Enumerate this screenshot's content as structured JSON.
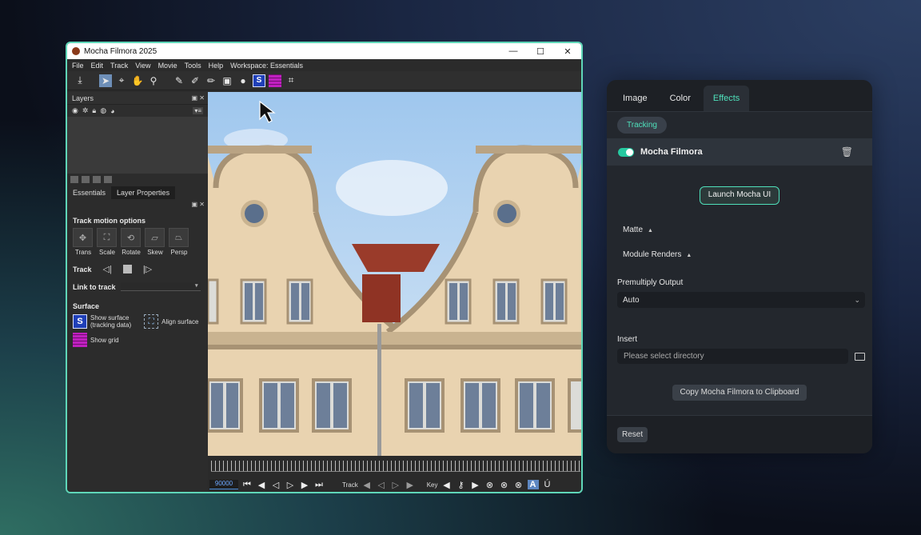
{
  "mocha": {
    "title": "Mocha Filmora 2025",
    "window_controls": [
      "—",
      "☐",
      "✕"
    ],
    "menu": [
      "File",
      "Edit",
      "Track",
      "View",
      "Movie",
      "Tools",
      "Help",
      "Workspace: Essentials"
    ],
    "layers_title": "Layers",
    "panel_tabs": [
      "Essentials",
      "Layer Properties"
    ],
    "track_motion_title": "Track motion options",
    "motion_options": [
      "Trans",
      "Scale",
      "Rotate",
      "Skew",
      "Persp"
    ],
    "track_label": "Track",
    "link_to_track_label": "Link to track",
    "surface_title": "Surface",
    "show_surface_label": "Show surface",
    "tracking_data_label": "(tracking data)",
    "align_surface_label": "Align surface",
    "show_grid_label": "Show grid",
    "timeline": {
      "frame": "90000",
      "track_label": "Track",
      "key_label": "Key"
    }
  },
  "filmora": {
    "tabs": [
      "Image",
      "Color",
      "Effects"
    ],
    "active_tab": "Effects",
    "subtab": "Tracking",
    "effect_name": "Mocha Filmora",
    "launch_button": "Launch Mocha UI",
    "matte_label": "Matte",
    "module_renders_label": "Module Renders",
    "premultiply_label": "Premultiply Output",
    "premultiply_value": "Auto",
    "insert_label": "Insert",
    "directory_placeholder": "Please select directory",
    "copy_button": "Copy Mocha Filmora to Clipboard",
    "reset_button": "Reset"
  },
  "colors": {
    "accent": "#4fe0bb",
    "window_border": "#5fd6b8",
    "selected_tool": "#6e8fb8"
  }
}
